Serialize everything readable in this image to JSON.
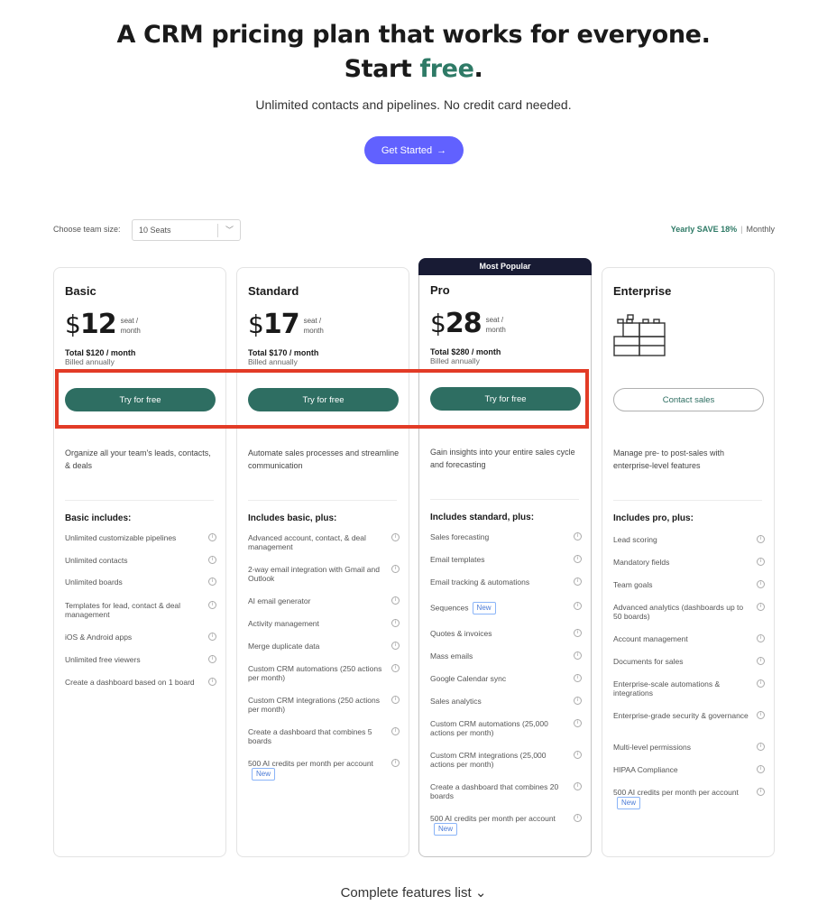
{
  "hero": {
    "title_line1": "A CRM pricing plan that works for everyone.",
    "title_start": "Start ",
    "title_free": "free",
    "title_period": ".",
    "subtitle": "Unlimited contacts and pipelines. No credit card needed.",
    "cta_label": "Get Started",
    "cta_arrow": "→",
    "accent_color": "#2e7a66",
    "cta_color": "#6161ff"
  },
  "controls": {
    "team_size_label": "Choose team size:",
    "team_size_value": "10 Seats",
    "team_size_chevron": "﹀",
    "yearly_label": "Yearly SAVE 18%",
    "separator": "|",
    "monthly_label": "Monthly"
  },
  "plans": [
    {
      "name": "Basic",
      "currency": "$",
      "price": "12",
      "per_seat": "seat / month",
      "total": "Total $120 / month",
      "billed": "Billed annually",
      "cta": "Try for free",
      "description": "Organize all your team's leads, contacts, & deals",
      "includes": "Basic includes:",
      "features": [
        {
          "text": "Unlimited customizable pipelines"
        },
        {
          "text": "Unlimited contacts"
        },
        {
          "text": "Unlimited boards"
        },
        {
          "text": "Templates for lead, contact & deal management"
        },
        {
          "text": "iOS & Android apps"
        },
        {
          "text": "Unlimited free viewers"
        },
        {
          "text": "Create a dashboard based on 1 board"
        }
      ]
    },
    {
      "name": "Standard",
      "currency": "$",
      "price": "17",
      "per_seat": "seat / month",
      "total": "Total $170 / month",
      "billed": "Billed annually",
      "cta": "Try for free",
      "description": "Automate sales processes and streamline communication",
      "includes": "Includes basic, plus:",
      "features": [
        {
          "text": "Advanced account, contact, & deal management"
        },
        {
          "text": "2-way email integration with Gmail and Outlook"
        },
        {
          "text": "AI email generator"
        },
        {
          "text": "Activity management"
        },
        {
          "text": "Merge duplicate data"
        },
        {
          "text": "Custom CRM automations (250 actions per month)"
        },
        {
          "text": "Custom CRM integrations (250 actions per month)"
        },
        {
          "text": "Create a dashboard that combines 5 boards"
        },
        {
          "text": "500 AI credits per month per account",
          "badge": "New"
        }
      ]
    },
    {
      "name": "Pro",
      "banner": "Most Popular",
      "currency": "$",
      "price": "28",
      "per_seat": "seat / month",
      "total": "Total $280 / month",
      "billed": "Billed annually",
      "cta": "Try for free",
      "description": "Gain insights into your entire sales cycle and forecasting",
      "includes": "Includes standard, plus:",
      "features": [
        {
          "text": "Sales forecasting"
        },
        {
          "text": "Email templates"
        },
        {
          "text": "Email tracking & automations"
        },
        {
          "text": "Sequences",
          "badge": "New"
        },
        {
          "text": "Quotes & invoices"
        },
        {
          "text": "Mass emails"
        },
        {
          "text": "Google Calendar sync"
        },
        {
          "text": "Sales analytics"
        },
        {
          "text": "Custom CRM automations (25,000 actions per month)"
        },
        {
          "text": "Custom CRM integrations (25,000 actions per month)"
        },
        {
          "text": "Create a dashboard that combines 20 boards"
        },
        {
          "text": "500 AI credits per month per account",
          "badge": "New"
        }
      ]
    },
    {
      "name": "Enterprise",
      "cta": "Contact sales",
      "description": "Manage pre- to post-sales with enterprise-level features",
      "includes": "Includes pro, plus:",
      "features": [
        {
          "text": "Lead scoring"
        },
        {
          "text": "Mandatory fields"
        },
        {
          "text": "Team goals"
        },
        {
          "text": "Advanced analytics (dashboards up to 50 boards)"
        },
        {
          "text": "Account management"
        },
        {
          "text": "Documents for sales"
        },
        {
          "text": "Enterprise-scale automations & integrations"
        },
        {
          "text": "Enterprise-grade security & governance"
        },
        {
          "text": "Multi-level permissions"
        },
        {
          "text": "HIPAA Compliance"
        },
        {
          "text": "500 AI credits per month per account",
          "badge": "New"
        }
      ]
    }
  ],
  "footer": {
    "complete_features": "Complete features list",
    "chevron": "⌄"
  }
}
